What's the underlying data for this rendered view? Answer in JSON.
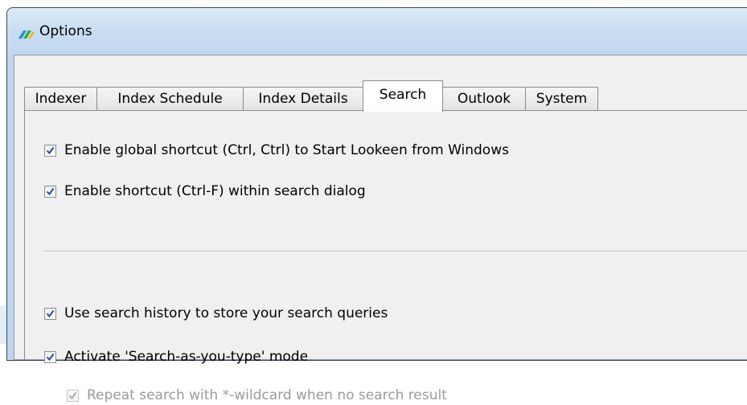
{
  "window": {
    "title": "Options",
    "icon": "lookeen-app-icon"
  },
  "tabs": [
    {
      "label": "Indexer",
      "active": false
    },
    {
      "label": "Index Schedule",
      "active": false
    },
    {
      "label": "Index Details",
      "active": false
    },
    {
      "label": "Search",
      "active": true
    },
    {
      "label": "Outlook",
      "active": false
    },
    {
      "label": "System",
      "active": false
    }
  ],
  "search_options": {
    "global_shortcut": {
      "label": "Enable global shortcut (Ctrl, Ctrl) to Start Lookeen from Windows",
      "checked": true
    },
    "dialog_shortcut": {
      "label": "Enable shortcut (Ctrl-F) within search dialog",
      "checked": true
    },
    "search_history": {
      "label": "Use search history to store your search queries",
      "checked": true
    },
    "search_as_you_type": {
      "label": "Activate 'Search-as-you-type' mode",
      "checked": true
    },
    "repeat_wildcard": {
      "label": "Repeat search with *-wildcard when no search result",
      "checked": true,
      "enabled": false
    }
  },
  "colors": {
    "frame": "#bed5ee",
    "panel": "#f0f0f0",
    "check": "#2a4d9b",
    "disabled_text": "#9a9a9a"
  }
}
